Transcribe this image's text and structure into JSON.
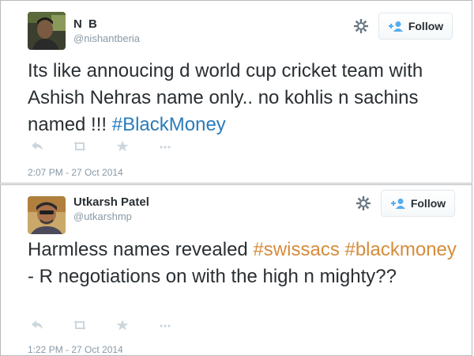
{
  "tweets": [
    {
      "name": "N B",
      "handle": "@nishantberia",
      "follow_label": "Follow",
      "text_plain": "Its like annoucing d world cup cricket team with Ashish Nehras name only.. no kohlis n sachins named !!! ",
      "hashtag": "#BlackMoney",
      "timestamp": "2:07 PM - 27 Oct 2014"
    },
    {
      "name": "Utkarsh Patel",
      "handle": "@utkarshmp",
      "follow_label": "Follow",
      "text_start": "Harmless names revealed ",
      "hashtag1": "#swissacs",
      "hashtag2": "#blackmoney",
      "text_end": " - R negotiations on with the high n mighty??",
      "timestamp": "1:22 PM - 27 Oct 2014"
    }
  ],
  "colors": {
    "hashtag_blue": "#2b7bb9",
    "hashtag_orange": "#d58c3b",
    "meta_gray": "#8899a6",
    "follow_icon_blue": "#55acee"
  },
  "icons": [
    "gear-icon",
    "follow-user-icon",
    "reply-icon",
    "retweet-icon",
    "favorite-icon",
    "more-icon"
  ]
}
